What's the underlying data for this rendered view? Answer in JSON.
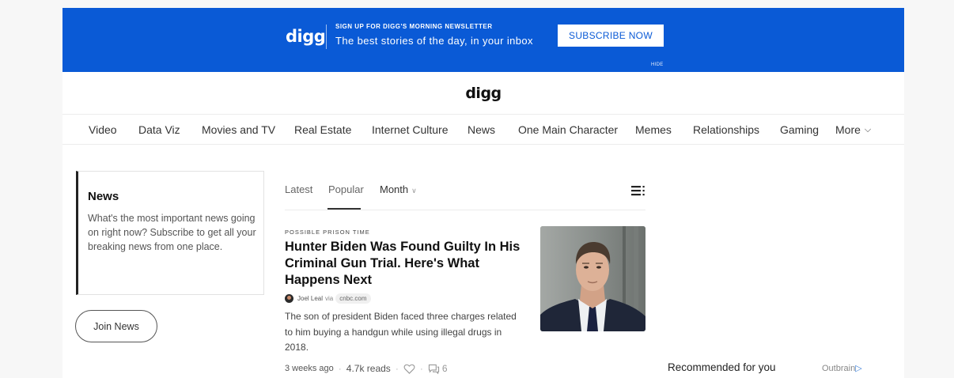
{
  "banner": {
    "logo": "digg",
    "kicker": "SIGN UP FOR DIGG'S MORNING NEWSLETTER",
    "tagline": "The best stories of the day, in your inbox",
    "subscribe_label": "SUBSCRIBE NOW",
    "hide_label": "HIDE",
    "color": "#0a5ad6"
  },
  "header": {
    "logo": "digg"
  },
  "nav": {
    "items": [
      {
        "label": "Video"
      },
      {
        "label": "Data Viz"
      },
      {
        "label": "Movies and TV"
      },
      {
        "label": "Real Estate"
      },
      {
        "label": "Internet Culture"
      },
      {
        "label": "News"
      },
      {
        "label": "One Main Character"
      },
      {
        "label": "Memes"
      },
      {
        "label": "Relationships"
      },
      {
        "label": "Gaming"
      },
      {
        "label": "More",
        "icon": "chevron-down-icon"
      }
    ]
  },
  "sidebar": {
    "title": "News",
    "description": "What's the most important news going on right now? Subscribe to get all your breaking news from one place.",
    "join_label": "Join News"
  },
  "feed": {
    "tabs": [
      {
        "label": "Latest"
      },
      {
        "label": "Popular",
        "active": true
      },
      {
        "label": "Month",
        "icon": "chevron-down-icon"
      }
    ],
    "view_icon": "list-view-icon",
    "article": {
      "kicker": "POSSIBLE PRISON TIME",
      "headline": "Hunter Biden Was Found Guilty In His Criminal Gun Trial. Here's What Happens Next",
      "author": "Joel Leal",
      "via": "via",
      "source": "cnbc.com",
      "summary": "The son of president Biden faced three charges related to him buying a handgun while using illegal drugs in 2018.",
      "age": "3 weeks ago",
      "reads": "4.7k reads",
      "comments": "6",
      "image": "article-photo"
    }
  },
  "recommendations": {
    "label": "Recommended for you",
    "provider": "Outbrain"
  }
}
